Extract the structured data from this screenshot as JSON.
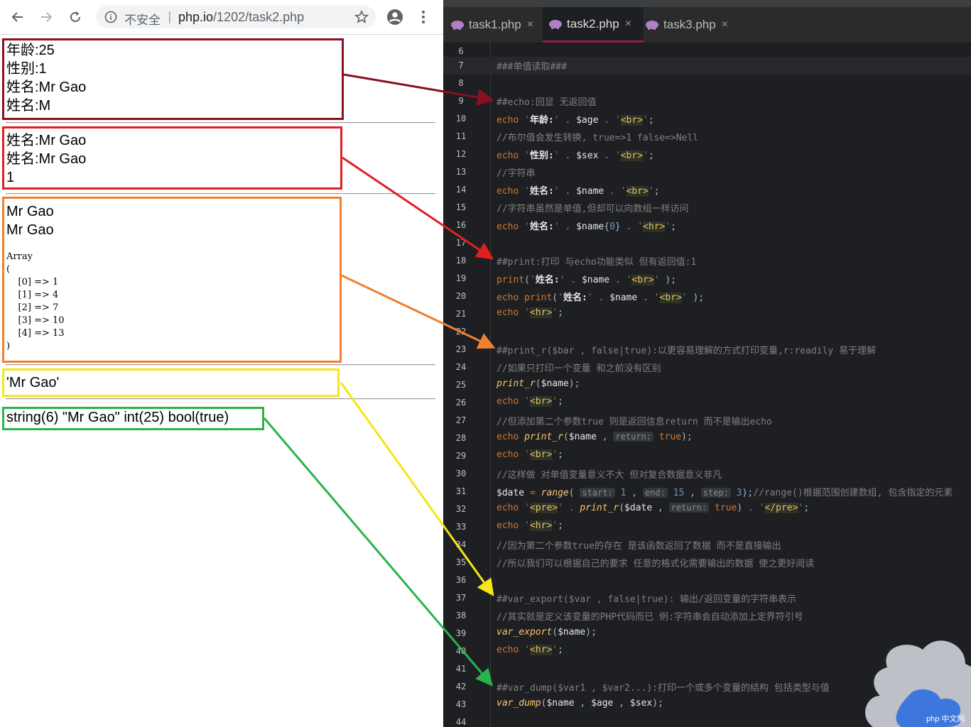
{
  "browser": {
    "security_label": "不安全",
    "separator": "|",
    "url_host": "php.io",
    "url_path": "/1202/task2.php"
  },
  "output": {
    "group1": [
      "年龄:25",
      "性别:1",
      "姓名:Mr Gao",
      "姓名:M"
    ],
    "group2": [
      "姓名:Mr Gao",
      "姓名:Mr Gao",
      "1"
    ],
    "group3_lines": [
      "Mr Gao",
      "Mr Gao"
    ],
    "group3_pre": "Array\n(\n    [0] => 1\n    [1] => 4\n    [2] => 7\n    [3] => 10\n    [4] => 13\n)",
    "group4": "'Mr Gao'",
    "group5": "string(6) \"Mr Gao\" int(25) bool(true)"
  },
  "editor": {
    "tabs": [
      {
        "label": "task1.php",
        "active": false
      },
      {
        "label": "task2.php",
        "active": true
      },
      {
        "label": "task3.php",
        "active": false
      }
    ],
    "close_glyph": "×",
    "watermark": "php 中文网"
  },
  "colors": {
    "arrow_1": "#8b1023",
    "arrow_2": "#e02020",
    "arrow_3": "#f08030",
    "arrow_4": "#f5e617",
    "arrow_5": "#2ab34a",
    "tab_active_underline": "#9b1b4a"
  }
}
